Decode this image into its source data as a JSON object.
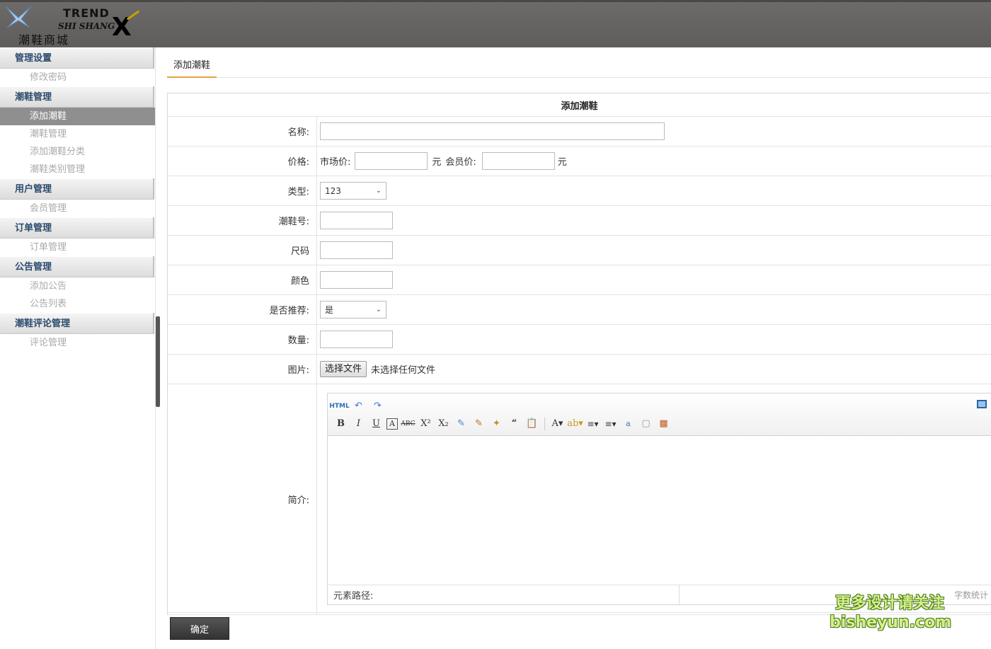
{
  "header": {
    "logo_en": "TREND",
    "logo_sub": "SHI SHANG",
    "logo_cn": "潮鞋商城",
    "logo_mark": "X"
  },
  "sidebar": {
    "groups": [
      {
        "title": "管理设置",
        "items": [
          "修改密码"
        ]
      },
      {
        "title": "潮鞋管理",
        "items": [
          "添加潮鞋",
          "潮鞋管理",
          "添加潮鞋分类",
          "潮鞋类别管理"
        ]
      },
      {
        "title": "用户管理",
        "items": [
          "会员管理"
        ]
      },
      {
        "title": "订单管理",
        "items": [
          "订单管理"
        ]
      },
      {
        "title": "公告管理",
        "items": [
          "添加公告",
          "公告列表"
        ]
      },
      {
        "title": "潮鞋评论管理",
        "items": [
          "评论管理"
        ]
      }
    ],
    "active_item": "添加潮鞋"
  },
  "tab": {
    "label": "添加潮鞋"
  },
  "form": {
    "title": "添加潮鞋",
    "name_label": "名称:",
    "price_label": "价格:",
    "market_price_label": "市场价:",
    "member_price_label": "会员价:",
    "yuan": "元",
    "type_label": "类型:",
    "type_value": "123",
    "code_label": "潮鞋号:",
    "size_label": "尺码",
    "color_label": "颜色",
    "recommend_label": "是否推荐:",
    "recommend_value": "是",
    "qty_label": "数量:",
    "image_label": "图片:",
    "file_button": "选择文件",
    "file_status": "未选择任何文件",
    "intro_label": "简介:",
    "editor_path": "元素路径:",
    "editor_count": "字数统计",
    "submit": "确定"
  },
  "watermark": {
    "line1": "更多设计请关注",
    "line2": "bisheyun.com"
  }
}
